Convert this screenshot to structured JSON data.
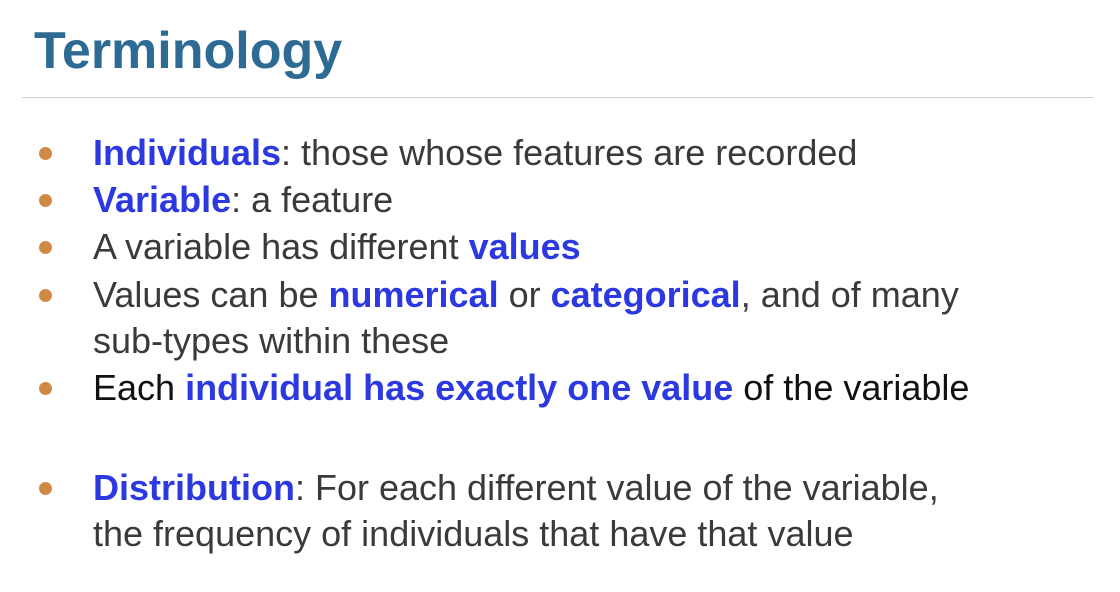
{
  "slide": {
    "title": "Terminology",
    "accent_color": "#2d6a94",
    "keyword_color": "#2c39e0",
    "bullet_color": "#d08a45",
    "bullets": [
      {
        "keyword": "Individuals",
        "rest": ": those whose features are recorded"
      },
      {
        "keyword": "Variable",
        "rest": ": a feature"
      },
      {
        "pre": "A variable has different ",
        "keyword": "values"
      },
      {
        "pre": "Values can be ",
        "keyword1": "numerical",
        "mid": " or ",
        "keyword2": "categorical",
        "post": ", and of many",
        "line2": "sub-types within these"
      },
      {
        "pre": "Each ",
        "keyword": "individual has exactly one value",
        "post": " of the variable"
      },
      {
        "keyword": "Distribution",
        "rest": ": For each different value of the variable,",
        "line2": "the frequency of individuals that have that value"
      }
    ]
  }
}
